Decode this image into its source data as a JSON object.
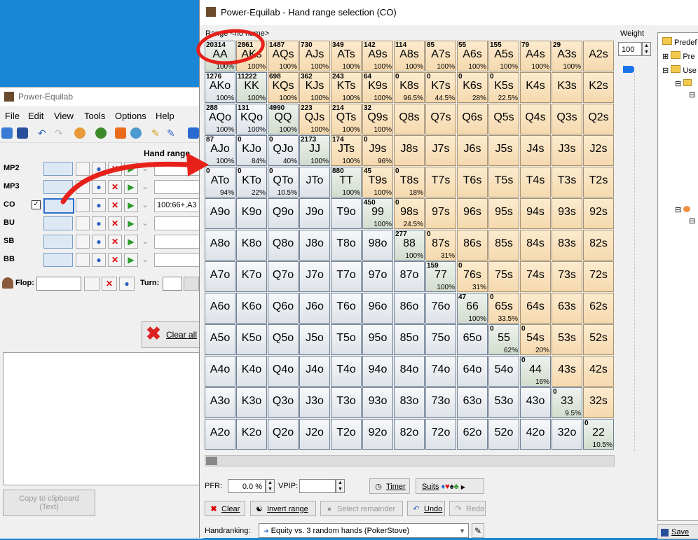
{
  "bg_window": {
    "title": "Power-Equilab",
    "menu": [
      "File",
      "Edit",
      "View",
      "Tools",
      "Options",
      "Help"
    ],
    "hand_range_header": "Hand range",
    "positions": [
      {
        "label": "MP2",
        "checked": false,
        "range": ""
      },
      {
        "label": "MP3",
        "checked": false,
        "range": ""
      },
      {
        "label": "CO",
        "checked": true,
        "range": "100:66+,A3"
      },
      {
        "label": "BU",
        "checked": false,
        "range": ""
      },
      {
        "label": "SB",
        "checked": false,
        "range": ""
      },
      {
        "label": "BB",
        "checked": false,
        "range": ""
      }
    ],
    "flop_label": "Flop:",
    "turn_label": "Turn:",
    "clear_all": "Clear all",
    "copy_clipboard_line1": "Copy to clipboard",
    "copy_clipboard_line2": "(Text)"
  },
  "dialog": {
    "title": "Power-Equilab - Hand range selection (CO)",
    "range_name": "Range <no name>",
    "weight_label": "Weight",
    "weight_value": "100",
    "pfr_label": "PFR:",
    "pfr_value": "0.0 %",
    "vpip_label": "VPIP:",
    "vpip_value": "",
    "buttons": {
      "timer": "Timer",
      "suits": "Suits",
      "clear": "Clear",
      "invert": "Invert range",
      "select_remainder": "Select remainder",
      "undo": "Undo",
      "redo": "Redo",
      "save": "Save"
    },
    "handranking_label": "Handranking:",
    "handranking_value": "Equity vs. 3 random hands (PokerStove)",
    "tree": [
      "Predef",
      "Pre",
      "Use"
    ]
  },
  "grid": [
    [
      {
        "h": "AA",
        "c": "20314",
        "p": "100%",
        "f": 1
      },
      {
        "h": "AKs",
        "c": "2861",
        "p": "100%",
        "f": 1
      },
      {
        "h": "AQs",
        "c": "1487",
        "p": "100%",
        "f": 1
      },
      {
        "h": "AJs",
        "c": "730",
        "p": "100%",
        "f": 1
      },
      {
        "h": "ATs",
        "c": "349",
        "p": "100%",
        "f": 1
      },
      {
        "h": "A9s",
        "c": "142",
        "p": "100%",
        "f": 1
      },
      {
        "h": "A8s",
        "c": "114",
        "p": "100%",
        "f": 1
      },
      {
        "h": "A7s",
        "c": "85",
        "p": "100%",
        "f": 1
      },
      {
        "h": "A6s",
        "c": "55",
        "p": "100%",
        "f": 1
      },
      {
        "h": "A5s",
        "c": "155",
        "p": "100%",
        "f": 1
      },
      {
        "h": "A4s",
        "c": "79",
        "p": "100%",
        "f": 1
      },
      {
        "h": "A3s",
        "c": "29",
        "p": "100%",
        "f": 1
      },
      {
        "h": "A2s",
        "c": "",
        "p": "",
        "f": 0
      }
    ],
    [
      {
        "h": "AKo",
        "c": "1276",
        "p": "100%",
        "f": 1
      },
      {
        "h": "KK",
        "c": "11222",
        "p": "100%",
        "f": 1
      },
      {
        "h": "KQs",
        "c": "698",
        "p": "100%",
        "f": 1
      },
      {
        "h": "KJs",
        "c": "362",
        "p": "100%",
        "f": 1
      },
      {
        "h": "KTs",
        "c": "243",
        "p": "100%",
        "f": 1
      },
      {
        "h": "K9s",
        "c": "64",
        "p": "100%",
        "f": 1
      },
      {
        "h": "K8s",
        "c": "0",
        "p": "96.5%",
        "f": 0.965
      },
      {
        "h": "K7s",
        "c": "0",
        "p": "44.5%",
        "f": 0.445
      },
      {
        "h": "K6s",
        "c": "0",
        "p": "28%",
        "f": 0.28
      },
      {
        "h": "K5s",
        "c": "0",
        "p": "22.5%",
        "f": 0.225
      },
      {
        "h": "K4s",
        "c": "",
        "p": "",
        "f": 0
      },
      {
        "h": "K3s",
        "c": "",
        "p": "",
        "f": 0
      },
      {
        "h": "K2s",
        "c": "",
        "p": "",
        "f": 0
      }
    ],
    [
      {
        "h": "AQo",
        "c": "288",
        "p": "100%",
        "f": 1
      },
      {
        "h": "KQo",
        "c": "131",
        "p": "100%",
        "f": 1
      },
      {
        "h": "QQ",
        "c": "4990",
        "p": "100%",
        "f": 1
      },
      {
        "h": "QJs",
        "c": "223",
        "p": "100%",
        "f": 1
      },
      {
        "h": "QTs",
        "c": "214",
        "p": "100%",
        "f": 1
      },
      {
        "h": "Q9s",
        "c": "32",
        "p": "100%",
        "f": 1
      },
      {
        "h": "Q8s",
        "c": "",
        "p": "",
        "f": 0
      },
      {
        "h": "Q7s",
        "c": "",
        "p": "",
        "f": 0
      },
      {
        "h": "Q6s",
        "c": "",
        "p": "",
        "f": 0
      },
      {
        "h": "Q5s",
        "c": "",
        "p": "",
        "f": 0
      },
      {
        "h": "Q4s",
        "c": "",
        "p": "",
        "f": 0
      },
      {
        "h": "Q3s",
        "c": "",
        "p": "",
        "f": 0
      },
      {
        "h": "Q2s",
        "c": "",
        "p": "",
        "f": 0
      }
    ],
    [
      {
        "h": "AJo",
        "c": "87",
        "p": "100%",
        "f": 1
      },
      {
        "h": "KJo",
        "c": "0",
        "p": "84%",
        "f": 0.84
      },
      {
        "h": "QJo",
        "c": "0",
        "p": "40%",
        "f": 0.4
      },
      {
        "h": "JJ",
        "c": "2173",
        "p": "100%",
        "f": 1
      },
      {
        "h": "JTs",
        "c": "174",
        "p": "100%",
        "f": 1
      },
      {
        "h": "J9s",
        "c": "0",
        "p": "96%",
        "f": 0.96
      },
      {
        "h": "J8s",
        "c": "",
        "p": "",
        "f": 0
      },
      {
        "h": "J7s",
        "c": "",
        "p": "",
        "f": 0
      },
      {
        "h": "J6s",
        "c": "",
        "p": "",
        "f": 0
      },
      {
        "h": "J5s",
        "c": "",
        "p": "",
        "f": 0
      },
      {
        "h": "J4s",
        "c": "",
        "p": "",
        "f": 0
      },
      {
        "h": "J3s",
        "c": "",
        "p": "",
        "f": 0
      },
      {
        "h": "J2s",
        "c": "",
        "p": "",
        "f": 0
      }
    ],
    [
      {
        "h": "ATo",
        "c": "0",
        "p": "94%",
        "f": 0.94
      },
      {
        "h": "KTo",
        "c": "0",
        "p": "22%",
        "f": 0.22
      },
      {
        "h": "QTo",
        "c": "0",
        "p": "10.5%",
        "f": 0.105
      },
      {
        "h": "JTo",
        "c": "",
        "p": "",
        "f": 0
      },
      {
        "h": "TT",
        "c": "880",
        "p": "100%",
        "f": 1
      },
      {
        "h": "T9s",
        "c": "45",
        "p": "100%",
        "f": 1
      },
      {
        "h": "T8s",
        "c": "0",
        "p": "18%",
        "f": 0.18
      },
      {
        "h": "T7s",
        "c": "",
        "p": "",
        "f": 0
      },
      {
        "h": "T6s",
        "c": "",
        "p": "",
        "f": 0
      },
      {
        "h": "T5s",
        "c": "",
        "p": "",
        "f": 0
      },
      {
        "h": "T4s",
        "c": "",
        "p": "",
        "f": 0
      },
      {
        "h": "T3s",
        "c": "",
        "p": "",
        "f": 0
      },
      {
        "h": "T2s",
        "c": "",
        "p": "",
        "f": 0
      }
    ],
    [
      {
        "h": "A9o",
        "c": "",
        "p": "",
        "f": 0
      },
      {
        "h": "K9o",
        "c": "",
        "p": "",
        "f": 0
      },
      {
        "h": "Q9o",
        "c": "",
        "p": "",
        "f": 0
      },
      {
        "h": "J9o",
        "c": "",
        "p": "",
        "f": 0
      },
      {
        "h": "T9o",
        "c": "",
        "p": "",
        "f": 0
      },
      {
        "h": "99",
        "c": "450",
        "p": "100%",
        "f": 1
      },
      {
        "h": "98s",
        "c": "0",
        "p": "24.5%",
        "f": 0.245
      },
      {
        "h": "97s",
        "c": "",
        "p": "",
        "f": 0
      },
      {
        "h": "96s",
        "c": "",
        "p": "",
        "f": 0
      },
      {
        "h": "95s",
        "c": "",
        "p": "",
        "f": 0
      },
      {
        "h": "94s",
        "c": "",
        "p": "",
        "f": 0
      },
      {
        "h": "93s",
        "c": "",
        "p": "",
        "f": 0
      },
      {
        "h": "92s",
        "c": "",
        "p": "",
        "f": 0
      }
    ],
    [
      {
        "h": "A8o",
        "c": "",
        "p": "",
        "f": 0
      },
      {
        "h": "K8o",
        "c": "",
        "p": "",
        "f": 0
      },
      {
        "h": "Q8o",
        "c": "",
        "p": "",
        "f": 0
      },
      {
        "h": "J8o",
        "c": "",
        "p": "",
        "f": 0
      },
      {
        "h": "T8o",
        "c": "",
        "p": "",
        "f": 0
      },
      {
        "h": "98o",
        "c": "",
        "p": "",
        "f": 0
      },
      {
        "h": "88",
        "c": "277",
        "p": "100%",
        "f": 1
      },
      {
        "h": "87s",
        "c": "0",
        "p": "31%",
        "f": 0.31
      },
      {
        "h": "86s",
        "c": "",
        "p": "",
        "f": 0
      },
      {
        "h": "85s",
        "c": "",
        "p": "",
        "f": 0
      },
      {
        "h": "84s",
        "c": "",
        "p": "",
        "f": 0
      },
      {
        "h": "83s",
        "c": "",
        "p": "",
        "f": 0
      },
      {
        "h": "82s",
        "c": "",
        "p": "",
        "f": 0
      }
    ],
    [
      {
        "h": "A7o",
        "c": "",
        "p": "",
        "f": 0
      },
      {
        "h": "K7o",
        "c": "",
        "p": "",
        "f": 0
      },
      {
        "h": "Q7o",
        "c": "",
        "p": "",
        "f": 0
      },
      {
        "h": "J7o",
        "c": "",
        "p": "",
        "f": 0
      },
      {
        "h": "T7o",
        "c": "",
        "p": "",
        "f": 0
      },
      {
        "h": "97o",
        "c": "",
        "p": "",
        "f": 0
      },
      {
        "h": "87o",
        "c": "",
        "p": "",
        "f": 0
      },
      {
        "h": "77",
        "c": "159",
        "p": "100%",
        "f": 1
      },
      {
        "h": "76s",
        "c": "0",
        "p": "31%",
        "f": 0.31
      },
      {
        "h": "75s",
        "c": "",
        "p": "",
        "f": 0
      },
      {
        "h": "74s",
        "c": "",
        "p": "",
        "f": 0
      },
      {
        "h": "73s",
        "c": "",
        "p": "",
        "f": 0
      },
      {
        "h": "72s",
        "c": "",
        "p": "",
        "f": 0
      }
    ],
    [
      {
        "h": "A6o",
        "c": "",
        "p": "",
        "f": 0
      },
      {
        "h": "K6o",
        "c": "",
        "p": "",
        "f": 0
      },
      {
        "h": "Q6o",
        "c": "",
        "p": "",
        "f": 0
      },
      {
        "h": "J6o",
        "c": "",
        "p": "",
        "f": 0
      },
      {
        "h": "T6o",
        "c": "",
        "p": "",
        "f": 0
      },
      {
        "h": "96o",
        "c": "",
        "p": "",
        "f": 0
      },
      {
        "h": "86o",
        "c": "",
        "p": "",
        "f": 0
      },
      {
        "h": "76o",
        "c": "",
        "p": "",
        "f": 0
      },
      {
        "h": "66",
        "c": "47",
        "p": "100%",
        "f": 1
      },
      {
        "h": "65s",
        "c": "0",
        "p": "33.5%",
        "f": 0.335
      },
      {
        "h": "64s",
        "c": "",
        "p": "",
        "f": 0
      },
      {
        "h": "63s",
        "c": "",
        "p": "",
        "f": 0
      },
      {
        "h": "62s",
        "c": "",
        "p": "",
        "f": 0
      }
    ],
    [
      {
        "h": "A5o",
        "c": "",
        "p": "",
        "f": 0
      },
      {
        "h": "K5o",
        "c": "",
        "p": "",
        "f": 0
      },
      {
        "h": "Q5o",
        "c": "",
        "p": "",
        "f": 0
      },
      {
        "h": "J5o",
        "c": "",
        "p": "",
        "f": 0
      },
      {
        "h": "T5o",
        "c": "",
        "p": "",
        "f": 0
      },
      {
        "h": "95o",
        "c": "",
        "p": "",
        "f": 0
      },
      {
        "h": "85o",
        "c": "",
        "p": "",
        "f": 0
      },
      {
        "h": "75o",
        "c": "",
        "p": "",
        "f": 0
      },
      {
        "h": "65o",
        "c": "",
        "p": "",
        "f": 0
      },
      {
        "h": "55",
        "c": "0",
        "p": "62%",
        "f": 0.62
      },
      {
        "h": "54s",
        "c": "0",
        "p": "20%",
        "f": 0.2
      },
      {
        "h": "53s",
        "c": "",
        "p": "",
        "f": 0
      },
      {
        "h": "52s",
        "c": "",
        "p": "",
        "f": 0
      }
    ],
    [
      {
        "h": "A4o",
        "c": "",
        "p": "",
        "f": 0
      },
      {
        "h": "K4o",
        "c": "",
        "p": "",
        "f": 0
      },
      {
        "h": "Q4o",
        "c": "",
        "p": "",
        "f": 0
      },
      {
        "h": "J4o",
        "c": "",
        "p": "",
        "f": 0
      },
      {
        "h": "T4o",
        "c": "",
        "p": "",
        "f": 0
      },
      {
        "h": "94o",
        "c": "",
        "p": "",
        "f": 0
      },
      {
        "h": "84o",
        "c": "",
        "p": "",
        "f": 0
      },
      {
        "h": "74o",
        "c": "",
        "p": "",
        "f": 0
      },
      {
        "h": "64o",
        "c": "",
        "p": "",
        "f": 0
      },
      {
        "h": "54o",
        "c": "",
        "p": "",
        "f": 0
      },
      {
        "h": "44",
        "c": "0",
        "p": "16%",
        "f": 0.16
      },
      {
        "h": "43s",
        "c": "",
        "p": "",
        "f": 0
      },
      {
        "h": "42s",
        "c": "",
        "p": "",
        "f": 0
      }
    ],
    [
      {
        "h": "A3o",
        "c": "",
        "p": "",
        "f": 0
      },
      {
        "h": "K3o",
        "c": "",
        "p": "",
        "f": 0
      },
      {
        "h": "Q3o",
        "c": "",
        "p": "",
        "f": 0
      },
      {
        "h": "J3o",
        "c": "",
        "p": "",
        "f": 0
      },
      {
        "h": "T3o",
        "c": "",
        "p": "",
        "f": 0
      },
      {
        "h": "93o",
        "c": "",
        "p": "",
        "f": 0
      },
      {
        "h": "83o",
        "c": "",
        "p": "",
        "f": 0
      },
      {
        "h": "73o",
        "c": "",
        "p": "",
        "f": 0
      },
      {
        "h": "63o",
        "c": "",
        "p": "",
        "f": 0
      },
      {
        "h": "53o",
        "c": "",
        "p": "",
        "f": 0
      },
      {
        "h": "43o",
        "c": "",
        "p": "",
        "f": 0
      },
      {
        "h": "33",
        "c": "0",
        "p": "9.5%",
        "f": 0.095
      },
      {
        "h": "32s",
        "c": "",
        "p": "",
        "f": 0
      }
    ],
    [
      {
        "h": "A2o",
        "c": "",
        "p": "",
        "f": 0
      },
      {
        "h": "K2o",
        "c": "",
        "p": "",
        "f": 0
      },
      {
        "h": "Q2o",
        "c": "",
        "p": "",
        "f": 0
      },
      {
        "h": "J2o",
        "c": "",
        "p": "",
        "f": 0
      },
      {
        "h": "T2o",
        "c": "",
        "p": "",
        "f": 0
      },
      {
        "h": "92o",
        "c": "",
        "p": "",
        "f": 0
      },
      {
        "h": "82o",
        "c": "",
        "p": "",
        "f": 0
      },
      {
        "h": "72o",
        "c": "",
        "p": "",
        "f": 0
      },
      {
        "h": "62o",
        "c": "",
        "p": "",
        "f": 0
      },
      {
        "h": "52o",
        "c": "",
        "p": "",
        "f": 0
      },
      {
        "h": "42o",
        "c": "",
        "p": "",
        "f": 0
      },
      {
        "h": "32o",
        "c": "",
        "p": "",
        "f": 0
      },
      {
        "h": "22",
        "c": "0",
        "p": "10.5%",
        "f": 0.105
      }
    ]
  ],
  "colors": {
    "selected": "#5aa5f5",
    "annotation": "#e8201a",
    "desktop": "#1a86d6"
  }
}
